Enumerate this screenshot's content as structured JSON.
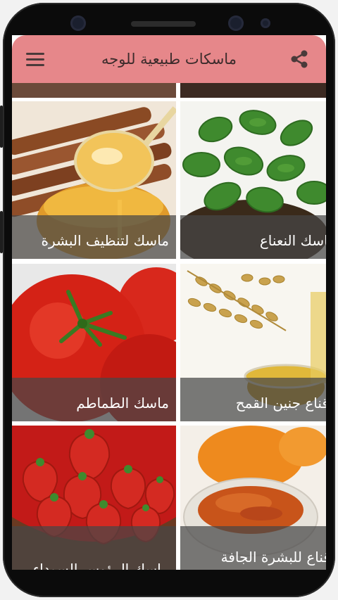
{
  "app": {
    "title": "ماسكات طبيعية للوجه",
    "menu_icon": "hamburger-menu-icon",
    "share_icon": "share-icon",
    "toolbar_color": "#e6878a"
  },
  "grid": {
    "items": [
      {
        "label": "ماسك لتنظيف البشرة",
        "image": "cinnamon-honey-spoon"
      },
      {
        "label": "ماسك النعناع",
        "image": "mint-leaves"
      },
      {
        "label": "ماسك الطماطم",
        "image": "tomatoes"
      },
      {
        "label": "قناع جنين القمح",
        "image": "wheat-germ-oil"
      },
      {
        "label": "ماسك الرؤوس السوداء",
        "image": "strawberries-bowl"
      },
      {
        "label": "قناع للبشرة الجافة",
        "image": "pumpkin-paste-bowl"
      }
    ]
  }
}
